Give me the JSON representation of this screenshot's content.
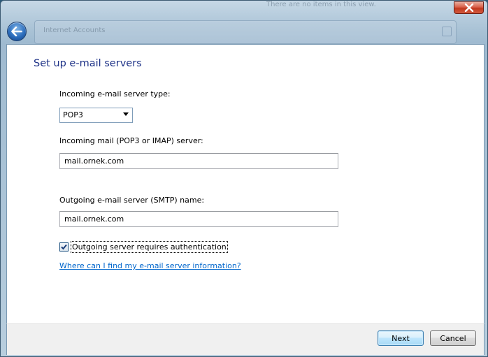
{
  "window": {
    "close_label": "Close",
    "background_title": "Internet Accounts",
    "background_hint": "There are no items in this view."
  },
  "page": {
    "title": "Set up e-mail servers"
  },
  "form": {
    "server_type_label": "Incoming e-mail server type:",
    "server_type_value": "POP3",
    "incoming_label": "Incoming mail (POP3 or IMAP) server:",
    "incoming_value": "mail.ornek.com",
    "outgoing_label": "Outgoing e-mail server (SMTP) name:",
    "outgoing_value": "mail.ornek.com",
    "auth_label": "Outgoing server requires authentication",
    "auth_checked": true,
    "help_link": "Where can I find my e-mail server information?"
  },
  "footer": {
    "next_label": "Next",
    "cancel_label": "Cancel"
  }
}
